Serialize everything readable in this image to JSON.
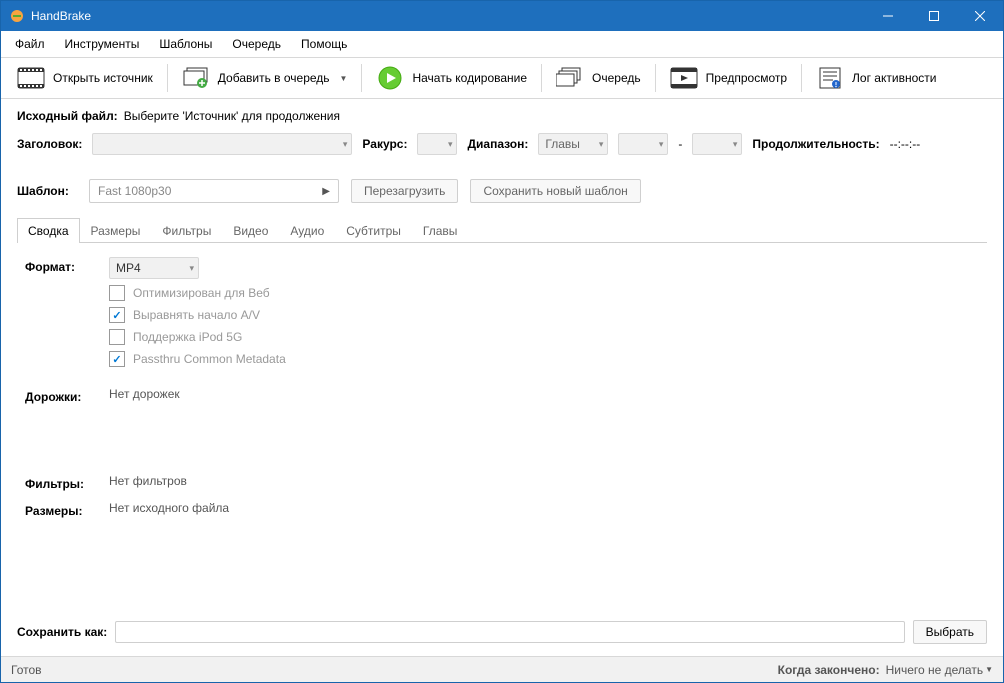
{
  "window": {
    "title": "HandBrake"
  },
  "menu": [
    "Файл",
    "Инструменты",
    "Шаблоны",
    "Очередь",
    "Помощь"
  ],
  "toolbar": {
    "open_source": "Открыть источник",
    "add_queue": "Добавить в очередь",
    "start_encode": "Начать кодирование",
    "queue": "Очередь",
    "preview": "Предпросмотр",
    "activity_log": "Лог активности"
  },
  "source": {
    "label": "Исходный файл:",
    "value": "Выберите 'Источник' для продолжения"
  },
  "title_row": {
    "title_label": "Заголовок:",
    "angle_label": "Ракурс:",
    "range_label": "Диапазон:",
    "range_value": "Главы",
    "dash": "-",
    "duration_label": "Продолжительность:",
    "duration_value": "--:--:--"
  },
  "preset": {
    "label": "Шаблон:",
    "value": "Fast 1080p30",
    "reload": "Перезагрузить",
    "save_new": "Сохранить новый шаблон"
  },
  "tabs": [
    "Сводка",
    "Размеры",
    "Фильтры",
    "Видео",
    "Аудио",
    "Субтитры",
    "Главы"
  ],
  "summary": {
    "format_label": "Формат:",
    "format_value": "MP4",
    "checks": [
      {
        "label": "Оптимизирован для Веб",
        "checked": false
      },
      {
        "label": "Выравнять начало A/V",
        "checked": true
      },
      {
        "label": "Поддержка iPod 5G",
        "checked": false
      },
      {
        "label": "Passthru Common Metadata",
        "checked": true
      }
    ],
    "tracks_label": "Дорожки:",
    "tracks_value": "Нет дорожек",
    "filters_label": "Фильтры:",
    "filters_value": "Нет фильтров",
    "dimensions_label": "Размеры:",
    "dimensions_value": "Нет исходного файла"
  },
  "save_as": {
    "label": "Сохранить как:",
    "browse": "Выбрать"
  },
  "status": {
    "ready": "Готов",
    "when_done_label": "Когда закончено:",
    "when_done_value": "Ничего не делать"
  }
}
